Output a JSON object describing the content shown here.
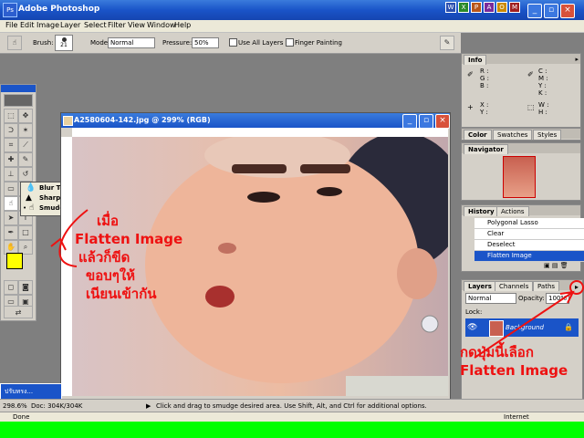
{
  "window": {
    "title": "Adobe Photoshop"
  },
  "menu": [
    "File",
    "Edit",
    "Image",
    "Layer",
    "Select",
    "Filter",
    "View",
    "Window",
    "Help"
  ],
  "options": {
    "brush_label": "Brush:",
    "brush_size": "21",
    "mode_label": "Mode:",
    "mode_value": "Normal",
    "pressure_label": "Pressure:",
    "pressure_value": "50%",
    "use_all_layers": "Use All Layers",
    "finger_painting": "Finger Painting"
  },
  "tool_flyout": [
    {
      "name": "Blur Tool",
      "key": "R"
    },
    {
      "name": "Sharpen Tool",
      "key": "R"
    },
    {
      "name": "Smudge Tool",
      "key": "R"
    }
  ],
  "document": {
    "title": "A2580604-142.jpg @ 299% (RGB)",
    "zoom": "298.6%",
    "doc_size": "Doc: 304K/304K",
    "status_hint": "Click and drag to smudge desired area. Use Shift, Alt, and Ctrl for additional options."
  },
  "info_panel": {
    "tab": "Info",
    "labels": [
      "R :",
      "G :",
      "B :",
      "C :",
      "M :",
      "Y :",
      "K :",
      "X :",
      "Y :",
      "W :",
      "H :"
    ]
  },
  "color_tabs": [
    "Color",
    "Swatches",
    "Styles"
  ],
  "navigator": {
    "tab": "Navigator"
  },
  "history": {
    "tabs": [
      "History",
      "Actions"
    ],
    "items": [
      "Polygonal Lasso",
      "Clear",
      "Deselect",
      "Flatten Image"
    ],
    "active_index": 3
  },
  "layers": {
    "tabs": [
      "Layers",
      "Channels",
      "Paths"
    ],
    "blend_mode": "Normal",
    "opacity_label": "Opacity:",
    "opacity_value": "100%",
    "lock_label": "Lock:",
    "layer_name": "Background"
  },
  "taskbar_item": "ปรับทรง...",
  "windows_status": {
    "left": "Done",
    "right": "Internet"
  },
  "annotations": {
    "left_note": [
      "เมื่อ",
      "Flatten Image",
      "แล้วก็ขีด",
      "ขอบๆให้",
      "เนียนเข้ากัน"
    ],
    "right_note": [
      "กดปุ่มนี้เลือก",
      "Flatten Image"
    ]
  },
  "colors": {
    "title_blue": "#1a54c8",
    "foreground_swatch": "#ffff00",
    "background_swatch": "#f4c8a0",
    "annotation_red": "#e11111",
    "green_strip": "#00ff00"
  }
}
